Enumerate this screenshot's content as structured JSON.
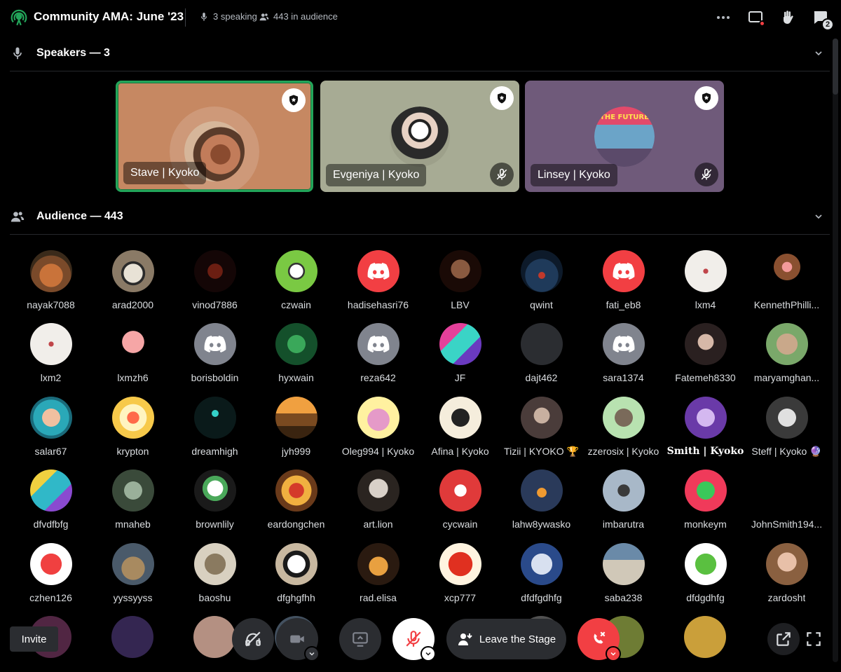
{
  "header": {
    "title": "Community AMA: June '23",
    "speaking": "3 speaking",
    "audience": "443 in audience",
    "inbox_count": "2"
  },
  "speakers_section": {
    "label": "Speakers — 3"
  },
  "audience_section": {
    "label": "Audience — 443"
  },
  "speakers": [
    {
      "name": "Stave | Kyoko",
      "bg": "#c68862",
      "active": true,
      "muted": false
    },
    {
      "name": "Evgeniya | Kyoko",
      "bg": "#a7ab94",
      "active": false,
      "muted": true
    },
    {
      "name": "Linsey | Kyoko",
      "bg": "#6f5a7a",
      "active": false,
      "muted": true
    }
  ],
  "audience": [
    "nayak7088",
    "arad2000",
    "vinod7886",
    "czwain",
    "hadisehasri76",
    "LBV",
    "qwint",
    "fati_eb8",
    "lxm4",
    "KennethPhilli...",
    "lxm2",
    "lxmzh6",
    "borisboldin",
    "hyxwain",
    "reza642",
    "JF",
    "dajt462",
    "sara1374",
    "Fatemeh8330",
    "maryamghan...",
    "salar67",
    "krypton",
    "dreamhigh",
    "jyh999",
    "Oleg994 | Kyoko",
    "Afina | Kyoko",
    "Tizii | KYOKO 🏆",
    "zzerosix | Kyoko",
    "Smith | Kyoko",
    "Steff | Kyoko 🔮",
    "dfvdfbfg",
    "mnaheb",
    "brownlily",
    "eardongchen",
    "art.lion",
    "cycwain",
    "lahw8ywasko",
    "imbarutra",
    "monkeym",
    "JohnSmith194...",
    "czhen126",
    "yyssyyss",
    "baoshu",
    "dfghgfhh",
    "rad.elisa",
    "xcp777",
    "dfdfgdhfg",
    "saba238",
    "dfdgdhfg",
    "zardosht"
  ],
  "controls": {
    "invite_label": "Invite",
    "leave_label": "Leave the Stage"
  },
  "colors": {
    "accent_green": "#23a55a",
    "discord_red": "#f23f43",
    "discord_grey": "#80848e"
  }
}
